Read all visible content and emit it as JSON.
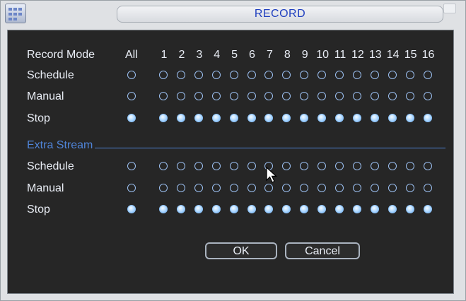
{
  "window": {
    "title": "RECORD"
  },
  "header": {
    "label": "Record Mode",
    "all_label": "All",
    "channels": [
      "1",
      "2",
      "3",
      "4",
      "5",
      "6",
      "7",
      "8",
      "9",
      "10",
      "11",
      "12",
      "13",
      "14",
      "15",
      "16"
    ]
  },
  "main_stream": {
    "rows": [
      {
        "label": "Schedule",
        "all_selected": false,
        "channels_selected": [
          false,
          false,
          false,
          false,
          false,
          false,
          false,
          false,
          false,
          false,
          false,
          false,
          false,
          false,
          false,
          false
        ]
      },
      {
        "label": "Manual",
        "all_selected": false,
        "channels_selected": [
          false,
          false,
          false,
          false,
          false,
          false,
          false,
          false,
          false,
          false,
          false,
          false,
          false,
          false,
          false,
          false
        ]
      },
      {
        "label": "Stop",
        "all_selected": true,
        "channels_selected": [
          true,
          true,
          true,
          true,
          true,
          true,
          true,
          true,
          true,
          true,
          true,
          true,
          true,
          true,
          true,
          true
        ]
      }
    ]
  },
  "extra_stream": {
    "label": "Extra Stream",
    "rows": [
      {
        "label": "Schedule",
        "all_selected": false,
        "channels_selected": [
          false,
          false,
          false,
          false,
          false,
          false,
          false,
          false,
          false,
          false,
          false,
          false,
          false,
          false,
          false,
          false
        ]
      },
      {
        "label": "Manual",
        "all_selected": false,
        "channels_selected": [
          false,
          false,
          false,
          false,
          false,
          false,
          false,
          false,
          false,
          false,
          false,
          false,
          false,
          false,
          false,
          false
        ]
      },
      {
        "label": "Stop",
        "all_selected": true,
        "channels_selected": [
          true,
          true,
          true,
          true,
          true,
          true,
          true,
          true,
          true,
          true,
          true,
          true,
          true,
          true,
          true,
          true
        ]
      }
    ]
  },
  "buttons": {
    "ok_label": "OK",
    "cancel_label": "Cancel"
  },
  "colors": {
    "panel_bg": "#262626",
    "text": "#e9edf5",
    "section_accent": "#4f84d8",
    "title_text": "#1f3fbf",
    "radio_selected": "#a7d4ff"
  },
  "icons": {
    "window": "record-window-icon",
    "cursor": "mouse-pointer-icon"
  }
}
